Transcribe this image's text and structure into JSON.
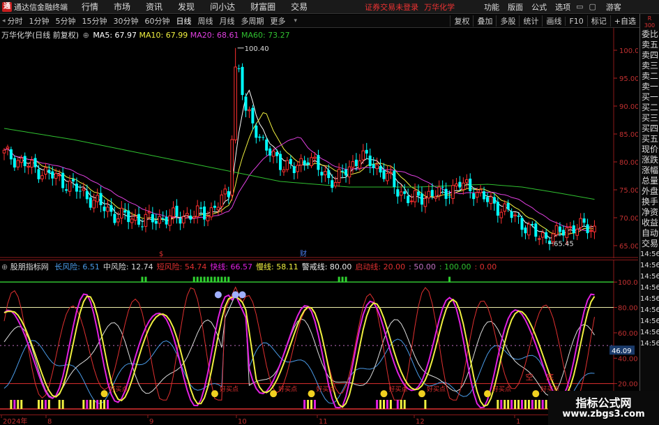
{
  "app": {
    "title": "通达信金融终端",
    "menu": [
      "行情",
      "市场",
      "资讯",
      "发现",
      "问小达",
      "财富圈",
      "交易"
    ],
    "login_status": "证券交易未登录",
    "stock_name": "万华化学",
    "right_menu": [
      "功能",
      "版面",
      "公式",
      "选项"
    ],
    "guest": "游客"
  },
  "toolbar": {
    "periods": [
      "分时",
      "1分钟",
      "5分钟",
      "15分钟",
      "30分钟",
      "60分钟",
      "日线",
      "周线",
      "月线",
      "多周期",
      "更多"
    ],
    "active_period": "日线",
    "tools": [
      "复权",
      "叠加",
      "多股",
      "统计",
      "画线",
      "F10",
      "标记"
    ],
    "add_watch": "+自选"
  },
  "side_panel": {
    "top_labels": [
      "R",
      "300"
    ],
    "items": [
      "委比",
      "卖五",
      "卖四",
      "卖三",
      "卖二",
      "卖一",
      "买一",
      "买二",
      "买三",
      "买四",
      "买五",
      "现价",
      "涨跌",
      "涨幅",
      "总量",
      "外盘",
      "换手",
      "净资",
      "收益",
      "自动",
      "交易",
      "14:56",
      "14:56",
      "14:56",
      "14:56",
      "14:56",
      "14:56",
      "14:56",
      "14:56",
      "14:56"
    ]
  },
  "main_info": {
    "stock_label": "万华化学(日线 前复权)",
    "ma5_label": "MA5: 67.97",
    "ma10_label": "MA10: 67.99",
    "ma20_label": "MA20: 68.61",
    "ma60_label": "MA60: 73.27",
    "high_label": "100.40",
    "low_label": "65.45",
    "price_ticks": [
      "100.0",
      "95.00",
      "90.00",
      "85.00",
      "80.00",
      "75.00",
      "70.00",
      "65.00"
    ],
    "markers": [
      "$",
      "财"
    ]
  },
  "indicator_info": {
    "name": "股朋指标网",
    "items": [
      {
        "label": "长风险: 6.51",
        "color": "#4a9be8"
      },
      {
        "label": "中风险: 12.74",
        "color": "#dddddd"
      },
      {
        "label": "短风险: 54.74",
        "color": "#e03030"
      },
      {
        "label": "快线: 66.57",
        "color": "#e020e0"
      },
      {
        "label": "慢线: 58.11",
        "color": "#f0f040"
      },
      {
        "label": "警戒线: 80.00",
        "color": "#eeeeee"
      },
      {
        "label": "启动线: 20.00",
        "color": "#e03030"
      },
      {
        "label": ": 50.00",
        "color": "#c070c0"
      },
      {
        "label": ": 100.00",
        "color": "#30c030"
      },
      {
        "label": ": 0.00",
        "color": "#e03030"
      }
    ],
    "ticks": [
      "100.00",
      "80.00",
      "60.00",
      "40.00",
      "20.00"
    ],
    "current_value": "46.09",
    "buy_label": "好买点",
    "short_label": "空",
    "bottom_label": "底"
  },
  "date_axis": [
    "2024年",
    "8",
    "9",
    "10",
    "11",
    "12",
    "1"
  ],
  "watermark": {
    "title": "指标公式网",
    "url": "www.zbgs3.com"
  },
  "colors": {
    "up": "#ff3030",
    "down": "#00ffff",
    "ma5": "#ffffff",
    "ma10": "#f0f040",
    "ma20": "#e040e0",
    "ma60": "#30c030"
  }
}
